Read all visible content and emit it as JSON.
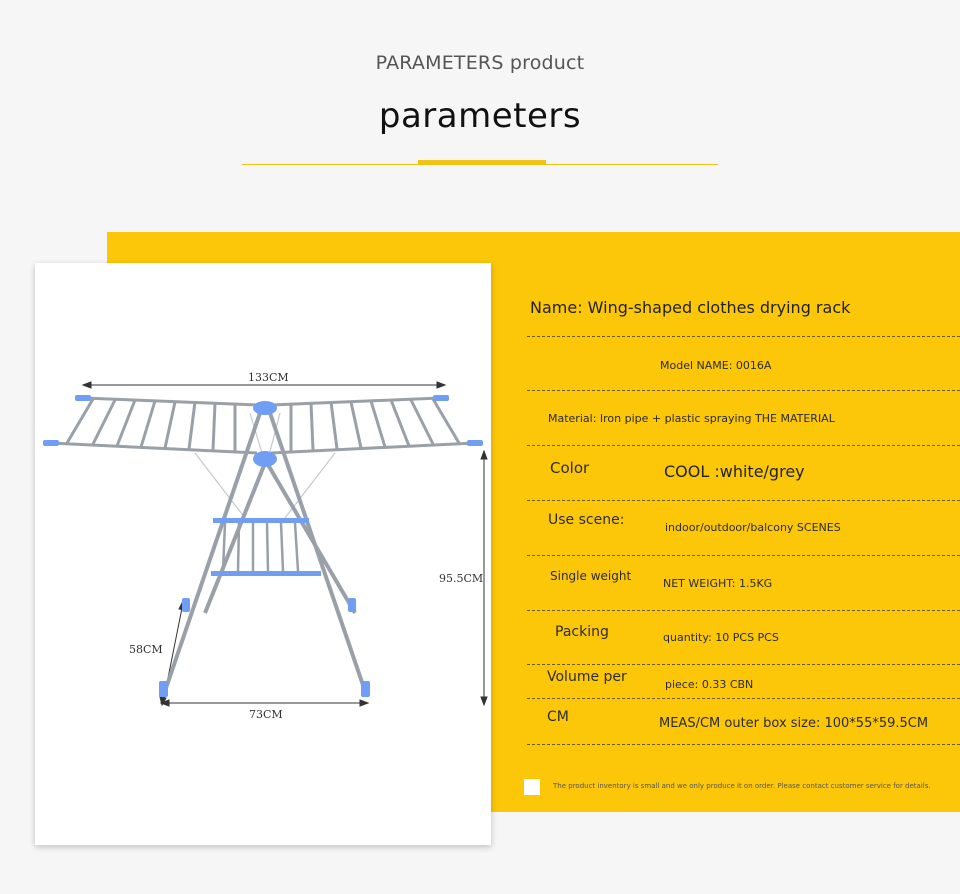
{
  "header": {
    "subtitle": "PARAMETERS product",
    "title": "parameters"
  },
  "colors": {
    "accent": "#fcc709",
    "rack_frame": "#9aa0a8",
    "rack_parts": "#6f9ef3"
  },
  "product_image": {
    "dimensions": {
      "width_top": "133CM",
      "height": "95.5CM",
      "depth": "58CM",
      "width_base": "73CM"
    }
  },
  "specs": {
    "name": "Name: Wing-shaped clothes drying rack",
    "model": "Model NAME: 0016A",
    "material": "Material: Iron pipe + plastic spraying THE MATERIAL",
    "color_label": "Color",
    "color_value": "COOL :white/grey",
    "scene_label": "Use scene:",
    "scene_value": "indoor/outdoor/balcony SCENES",
    "weight_label": "Single weight",
    "weight_value": "NET WEIGHT: 1.5KG",
    "packing_label": "Packing",
    "packing_value": "quantity: 10 PCS PCS",
    "volume_label": "Volume per",
    "volume_value": "piece: 0.33 CBN",
    "cm_label": "CM",
    "meas_value": "MEAS/CM outer box size: 100*55*59.5CM"
  },
  "footer_note": "The product inventory is small and we only produce it on order. Please contact customer service for details."
}
